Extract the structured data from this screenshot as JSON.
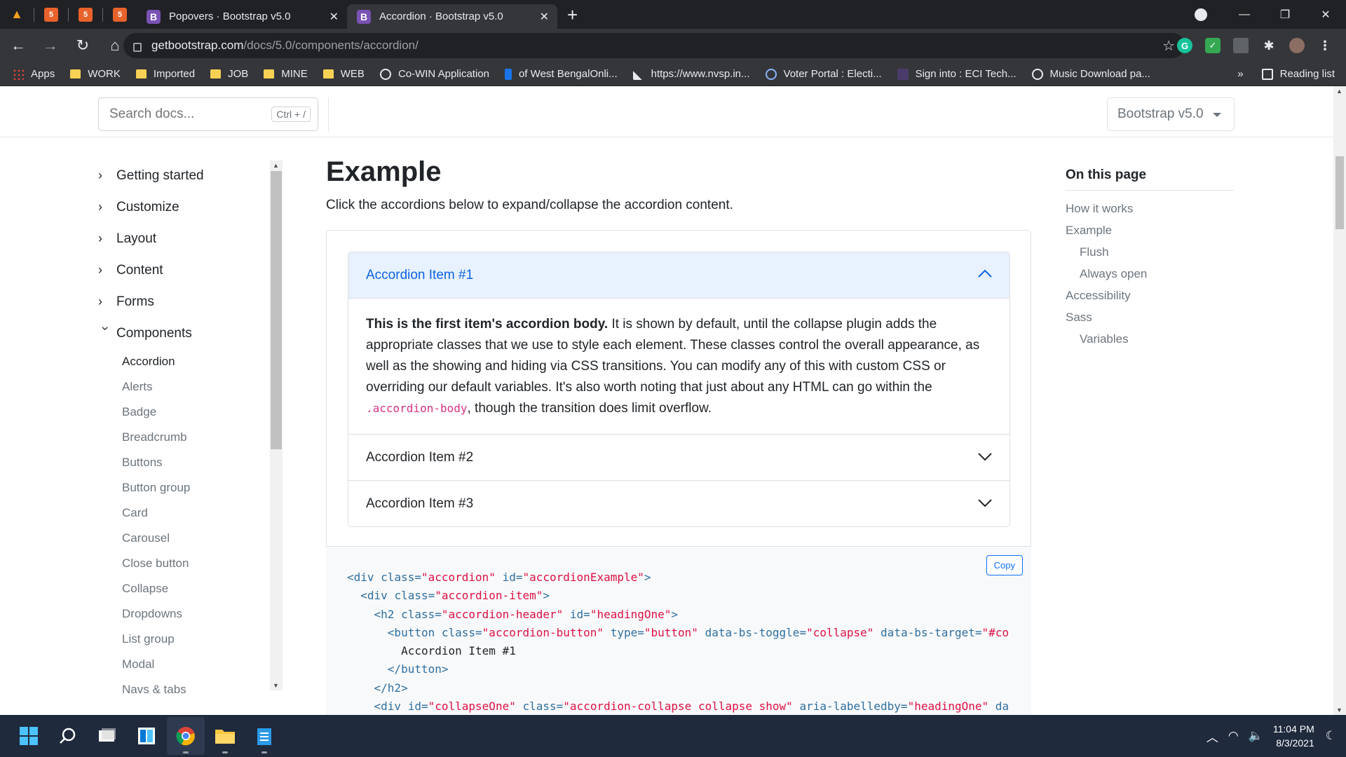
{
  "browser": {
    "tabs": [
      {
        "title": "Popovers · Bootstrap v5.0",
        "active": false
      },
      {
        "title": "Accordion · Bootstrap v5.0",
        "active": true
      }
    ],
    "url_host": "getbootstrap.com",
    "url_path": "/docs/5.0/components/accordion/",
    "bookmarks": [
      {
        "label": "Apps",
        "icon": "apps-grid-icon"
      },
      {
        "label": "WORK",
        "icon": "folder-icon"
      },
      {
        "label": "Imported",
        "icon": "folder-icon"
      },
      {
        "label": "JOB",
        "icon": "folder-icon"
      },
      {
        "label": "MINE",
        "icon": "folder-icon"
      },
      {
        "label": "WEB",
        "icon": "folder-icon"
      },
      {
        "label": "Co-WIN Application",
        "icon": "globe-icon"
      },
      {
        "label": "of West BengalOnli...",
        "icon": "page-icon"
      },
      {
        "label": "https://www.nvsp.in...",
        "icon": "page-icon"
      },
      {
        "label": "Voter Portal : Electi...",
        "icon": "globe-icon"
      },
      {
        "label": "Sign into : ECI Tech...",
        "icon": "page-icon"
      },
      {
        "label": "Music Download pa...",
        "icon": "globe-icon"
      }
    ],
    "bookmarks_overflow": "»",
    "reading_list": "Reading list"
  },
  "docs": {
    "search_placeholder": "Search docs...",
    "search_shortcut": "Ctrl + /",
    "version": "Bootstrap v5.0",
    "sidebar": {
      "groups": [
        "Getting started",
        "Customize",
        "Layout",
        "Content",
        "Forms"
      ],
      "open_group": "Components",
      "links": [
        "Accordion",
        "Alerts",
        "Badge",
        "Breadcrumb",
        "Buttons",
        "Button group",
        "Card",
        "Carousel",
        "Close button",
        "Collapse",
        "Dropdowns",
        "List group",
        "Modal",
        "Navs & tabs"
      ]
    },
    "heading": "Example",
    "lead": "Click the accordions below to expand/collapse the accordion content.",
    "accordion": {
      "item1": "Accordion Item #1",
      "item2": "Accordion Item #2",
      "item3": "Accordion Item #3",
      "body_strong": "This is the first item's accordion body.",
      "body_text": " It is shown by default, until the collapse plugin adds the appropriate classes that we use to style each element. These classes control the overall appearance, as well as the showing and hiding via CSS transitions. You can modify any of this with custom CSS or overriding our default variables. It's also worth noting that just about any HTML can go within the ",
      "body_code": ".accordion-body",
      "body_tail": ", though the transition does limit overflow."
    },
    "copy_label": "Copy",
    "toc": {
      "title": "On this page",
      "items": [
        {
          "label": "How it works",
          "sub": false
        },
        {
          "label": "Example",
          "sub": false
        },
        {
          "label": "Flush",
          "sub": true
        },
        {
          "label": "Always open",
          "sub": true
        },
        {
          "label": "Accessibility",
          "sub": false
        },
        {
          "label": "Sass",
          "sub": false
        },
        {
          "label": "Variables",
          "sub": true
        }
      ]
    }
  },
  "taskbar": {
    "time": "11:04 PM",
    "date": "8/3/2021"
  }
}
